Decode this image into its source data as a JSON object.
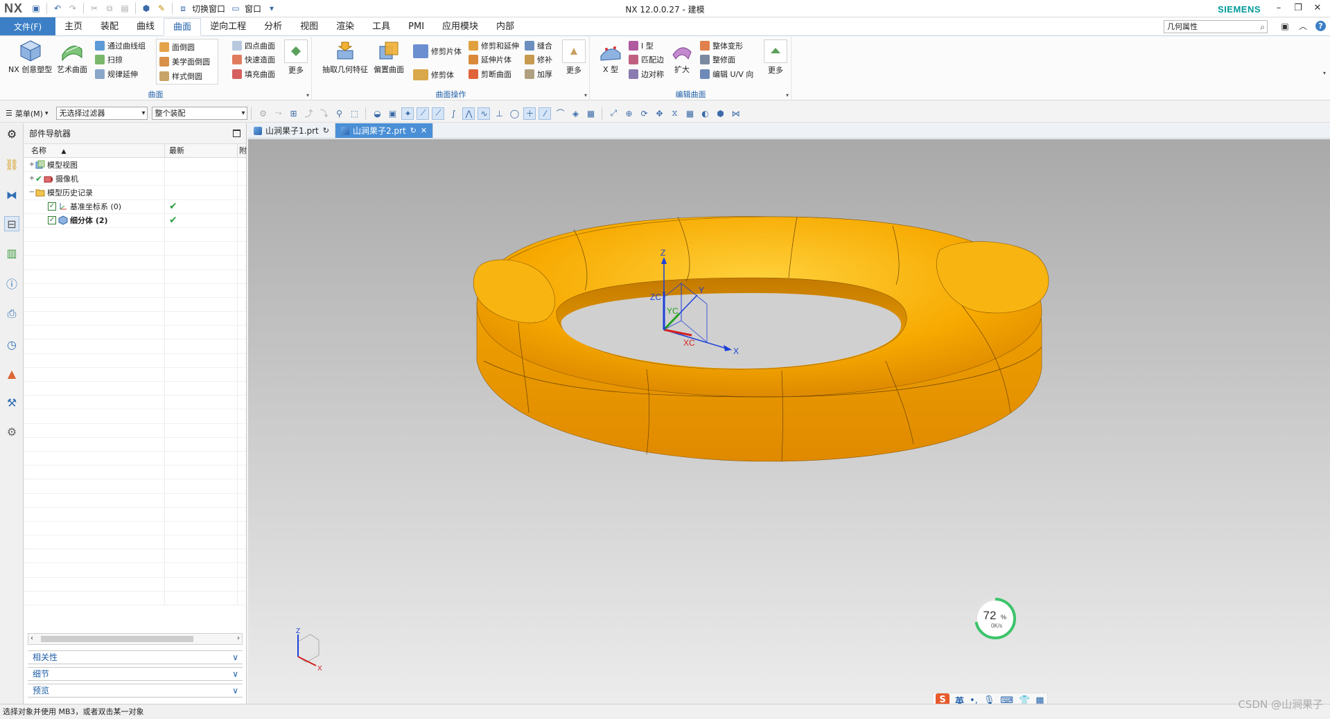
{
  "app": {
    "logo": "NX",
    "title": "NX 12.0.0.27 - 建模",
    "brand": "SIEMENS",
    "quick_access": {
      "switch_window": "切换窗口",
      "window": "窗口"
    }
  },
  "tabs": {
    "file": "文件(F)",
    "items": [
      "主页",
      "装配",
      "曲线",
      "曲面",
      "逆向工程",
      "分析",
      "视图",
      "渲染",
      "工具",
      "PMI",
      "应用模块",
      "内部"
    ],
    "active": "曲面"
  },
  "search": {
    "value": "几何属性"
  },
  "ribbon": {
    "surface_group": {
      "label": "曲面",
      "big": [
        "NX 创意塑型",
        "艺术曲面"
      ],
      "col1": [
        "通过曲线组",
        "扫掠",
        "规律延伸"
      ],
      "col2": [
        "面倒圆",
        "美学面倒圆",
        "样式倒圆"
      ],
      "col3": [
        "四点曲面",
        "快速造面",
        "填充曲面"
      ],
      "more": "更多"
    },
    "surface_ops": {
      "label": "曲面操作",
      "big": [
        "抽取几何特征",
        "偏置曲面"
      ],
      "col1": [
        "修剪片体",
        "修剪体"
      ],
      "col2": [
        "修剪和延伸",
        "延伸片体",
        "剪断曲面"
      ],
      "col3": [
        "缝合",
        "修补",
        "加厚"
      ],
      "more": "更多"
    },
    "edit_surface": {
      "label": "编辑曲面",
      "big": [
        "X 型",
        "扩大"
      ],
      "col1": [
        "I 型",
        "匹配边",
        "边对称"
      ],
      "col2": [
        "整体变形",
        "整修面",
        "编辑 U/V 向"
      ],
      "more": "更多"
    }
  },
  "selection_bar": {
    "menu": "菜单(M)",
    "filter": "无选择过滤器",
    "scope": "整个装配"
  },
  "navigator": {
    "title": "部件导航器",
    "columns": {
      "name": "名称",
      "latest": "最新"
    },
    "rows": [
      {
        "name": "模型视图",
        "latest": ""
      },
      {
        "name": "摄像机",
        "latest": ""
      },
      {
        "name": "模型历史记录",
        "latest": ""
      },
      {
        "name": "基准坐标系 (0)",
        "latest": "✔"
      },
      {
        "name": "细分体 (2)",
        "latest": "✔"
      }
    ],
    "panels": [
      "相关性",
      "细节",
      "预览"
    ]
  },
  "doc_tabs": [
    {
      "name": "山涧果子1.prt"
    },
    {
      "name": "山涧果子2.prt"
    }
  ],
  "viewport": {
    "csys_labels": {
      "z": "Z",
      "zc": "ZC",
      "yc": "YC",
      "y": "Y",
      "xc": "XC",
      "x": "X"
    },
    "triad": {
      "z": "Z",
      "x": "X"
    },
    "perf": {
      "value": "72",
      "unit": "%",
      "rate": "0K/s"
    },
    "model_color": "#f7a900"
  },
  "status": {
    "message": "选择对象并使用 MB3，或者双击某一对象"
  },
  "ime": {
    "lang": "英"
  },
  "watermark": "CSDN @山涧果子"
}
